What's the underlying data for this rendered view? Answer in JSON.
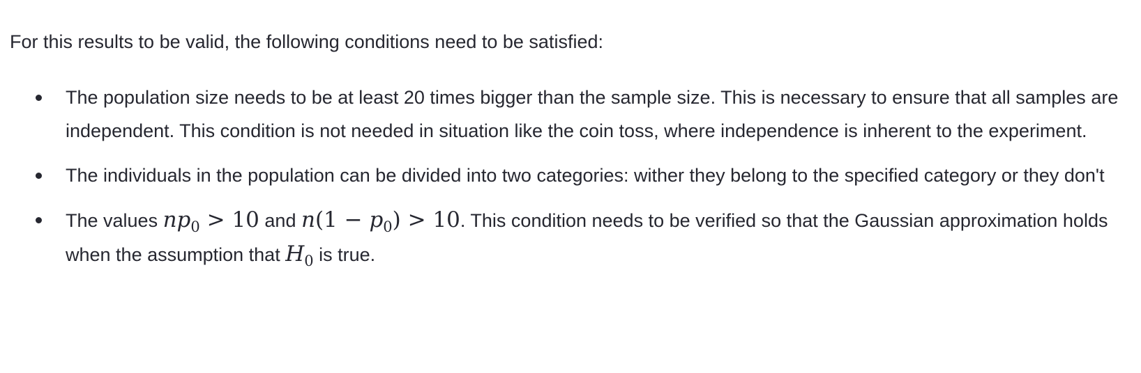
{
  "intro": "For this results to be valid, the following conditions need to be satisfied:",
  "conditions": [
    {
      "text": "The population size needs to be at least 20 times bigger than the sample size. This is necessary to ensure that all samples are independent. This condition is not needed in situation like the coin toss, where independence is inherent to the experiment."
    },
    {
      "text": "The individuals in the population can be divided into two categories: wither they belong to the specified category or they don't"
    },
    {
      "text_1": "The values ",
      "math_1_var": "np",
      "math_1_sub": "0",
      "math_1_rest": " > 10",
      "text_2": " and ",
      "math_2_var_1": "n",
      "math_2_mid": "(1 − ",
      "math_2_var_2": "p",
      "math_2_sub": "0",
      "math_2_rest": ") > 10",
      "text_3": ". This condition needs to be verified so that the Gaussian approximation holds when the assumption that ",
      "math_3_var": "H",
      "math_3_sub": "0",
      "text_4": " is true."
    }
  ],
  "colors": {
    "text": "#262730",
    "background": "#ffffff"
  }
}
